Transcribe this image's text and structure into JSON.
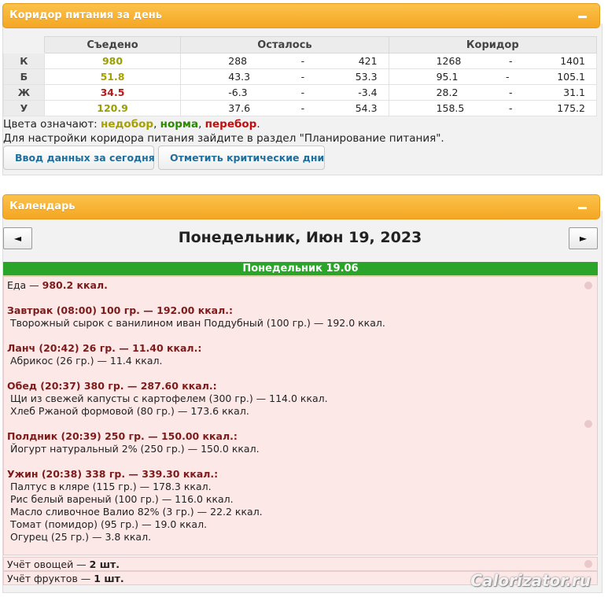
{
  "corridor_panel": {
    "title": "Коридор питания за день",
    "columns": [
      "Съедено",
      "Осталось",
      "Коридор"
    ],
    "rows": [
      {
        "label": "К",
        "eaten": "980",
        "left_min": "288",
        "left_sep": "-",
        "left_max": "421",
        "cor_min": "1268",
        "cor_sep": "-",
        "cor_max": "1401",
        "status": "norm"
      },
      {
        "label": "Б",
        "eaten": "51.8",
        "left_min": "43.3",
        "left_sep": "-",
        "left_max": "53.3",
        "cor_min": "95.1",
        "cor_sep": "-",
        "cor_max": "105.1",
        "status": "under"
      },
      {
        "label": "Ж",
        "eaten": "34.5",
        "left_min": "-6.3",
        "left_sep": "-",
        "left_max": "-3.4",
        "cor_min": "28.2",
        "cor_sep": "-",
        "cor_max": "31.1",
        "status": "over"
      },
      {
        "label": "У",
        "eaten": "120.9",
        "left_min": "37.6",
        "left_sep": "-",
        "left_max": "54.3",
        "cor_min": "158.5",
        "cor_sep": "-",
        "cor_max": "175.2",
        "status": "norm"
      }
    ],
    "legend_prefix": "Цвета означают: ",
    "legend_under": "недобор",
    "legend_comma1": ", ",
    "legend_norm": "норма",
    "legend_comma2": ", ",
    "legend_over": "перебор",
    "legend_end": ".",
    "hint": "Для настройки коридора питания зайдите в раздел \"Планирование питания\".",
    "btn_today": "Ввод данных за сегодня",
    "btn_critical": "Отметить критические дни",
    "colors": {
      "under": "#a7a000",
      "norm": "#2a8a00",
      "over": "#c01010",
      "header": "#f5a623"
    }
  },
  "calendar_panel": {
    "title": "Календарь",
    "prev": "◄",
    "next": "►",
    "date_title": "Понедельник, Июн 19, 2023",
    "day_header": "Понедельник 19.06",
    "food_total_prefix": "Еда — ",
    "food_total_value": "980.2 ккал.",
    "meals": [
      {
        "title": "Завтрак (08:00) 100 гр. — 192.00 ккал.:",
        "items": [
          "Творожный сырок с ванилином иван Поддубный (100 гр.) — 192.0 ккал."
        ]
      },
      {
        "title": "Ланч (20:42) 26 гр. — 11.40 ккал.:",
        "items": [
          "Абрикос (26 гр.) — 11.4 ккал."
        ]
      },
      {
        "title": "Обед (20:37) 380 гр. — 287.60 ккал.:",
        "items": [
          "Щи из свежей капусты с картофелем (300 гр.) — 114.0 ккал.",
          "Хлеб Ржаной формовой (80 гр.) — 173.6 ккал."
        ]
      },
      {
        "title": "Полдник (20:39) 250 гр. — 150.00 ккал.:",
        "items": [
          "Йогурт натуральный 2% (250 гр.) — 150.0 ккал."
        ]
      },
      {
        "title": "Ужин (20:38) 338 гр. — 339.30 ккал.:",
        "items": [
          "Палтус в кляре (115 гр.) — 178.3 ккал.",
          "Рис белый вареный (100 гр.) — 116.0 ккал.",
          "Масло сливочное Валио 82% (3 гр.) — 22.2 ккал.",
          "Томат (помидор) (95 гр.) — 19.0 ккал.",
          "Огурец (25 гр.) — 3.8 ккал."
        ]
      }
    ],
    "veg_prefix": "Учёт овощей — ",
    "veg_value": "2 шт.",
    "fruit_prefix": "Учёт фруктов — ",
    "fruit_value": "1 шт."
  },
  "watermark": "Calorizator.ru"
}
